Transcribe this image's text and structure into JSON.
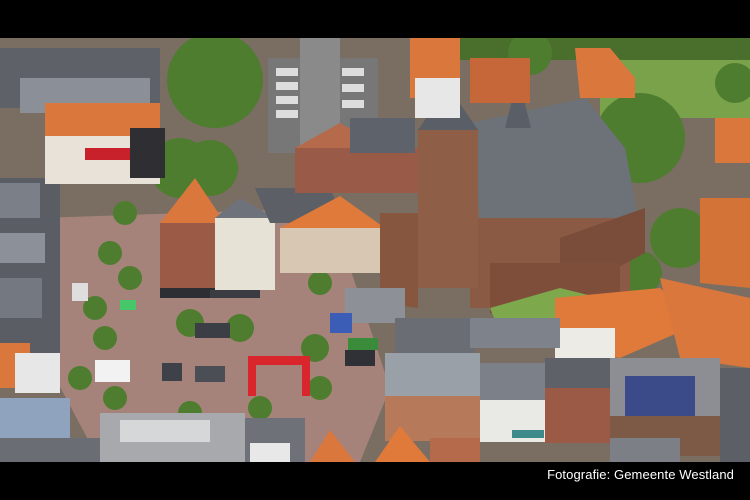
{
  "photo": {
    "credit": "Fotografie: Gemeente Westland",
    "subject_icon": "aerial-town-photo"
  },
  "colors": {
    "letterbox": "#000000",
    "credit_text": "#ffffff",
    "church_brick": "#8a5a44",
    "roof_orange": "#d9773d",
    "roof_slate": "#6e727a",
    "plaza_paving": "#a6837a",
    "arch_red": "#d8262c",
    "foliage": "#4f7d2f"
  }
}
